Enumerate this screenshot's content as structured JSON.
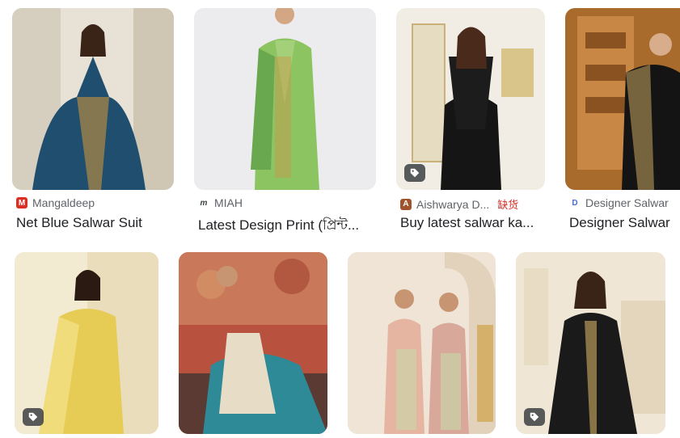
{
  "results": [
    {
      "source": "Mangaldeep",
      "title": "Net Blue Salwar Suit",
      "favicon_color": "#d93025",
      "favicon_letter": "M"
    },
    {
      "source": "MIAH",
      "title": "Latest Design Print (প্রিন্ট...",
      "favicon_color": "#3c4043",
      "favicon_letter": "m"
    },
    {
      "source": "Aishwarya D...",
      "title": "Buy latest salwar ka...",
      "badge": "缺货",
      "favicon_color": "#a0522d",
      "favicon_letter": "A"
    },
    {
      "source": "Designer Salwar",
      "title": "Designer Salwar",
      "favicon_color": "#4a6cd4",
      "favicon_letter": "D"
    }
  ],
  "icons": {
    "product_tag": "tag-icon"
  },
  "colors": {
    "text_primary": "#202124",
    "text_secondary": "#5f6368",
    "out_of_stock": "#d93025"
  }
}
